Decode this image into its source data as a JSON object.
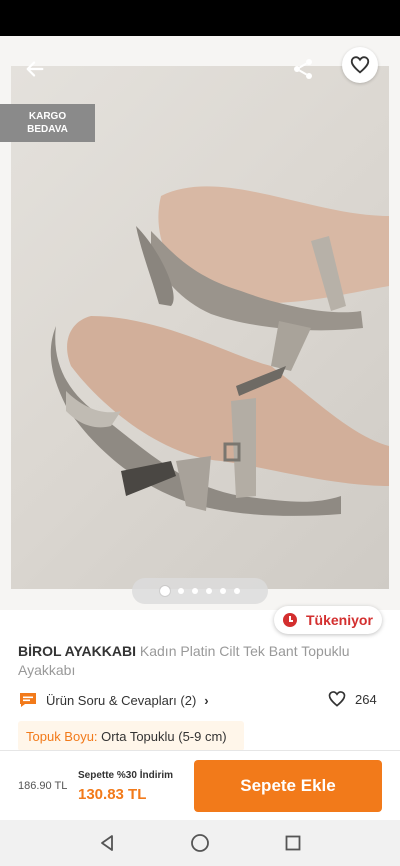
{
  "product": {
    "shipping_badge": [
      "KARGO",
      "BEDAVA"
    ],
    "stock_status": "Tükeniyor",
    "brand": "BİROL AYAKKABI",
    "name": "Kadın Platin Cilt Tek Bant Topuklu Ayakkabı",
    "qa_label": "Ürün Soru & Cevapları (2)",
    "favorite_count": "264",
    "attribute": {
      "key": "Topuk Boyu:",
      "value": "Orta Topuklu (5-9 cm)"
    }
  },
  "gallery": {
    "image_count": 6,
    "active_index": 0
  },
  "pricing": {
    "old_price": "186.90 TL",
    "promo_text": "Sepette %30 İndirim",
    "new_price": "130.83 TL",
    "add_to_cart_label": "Sepete Ekle"
  },
  "colors": {
    "accent": "#f27a1a",
    "stock_red": "#d32f2f",
    "badge_gray": "#8a8a8a"
  },
  "icons": {
    "back": "arrow-left-icon",
    "share": "share-icon",
    "favorite": "heart-outline-icon",
    "qa": "chat-bubble-icon",
    "nav": [
      "triangle-back-icon",
      "circle-home-icon",
      "square-recents-icon"
    ]
  }
}
